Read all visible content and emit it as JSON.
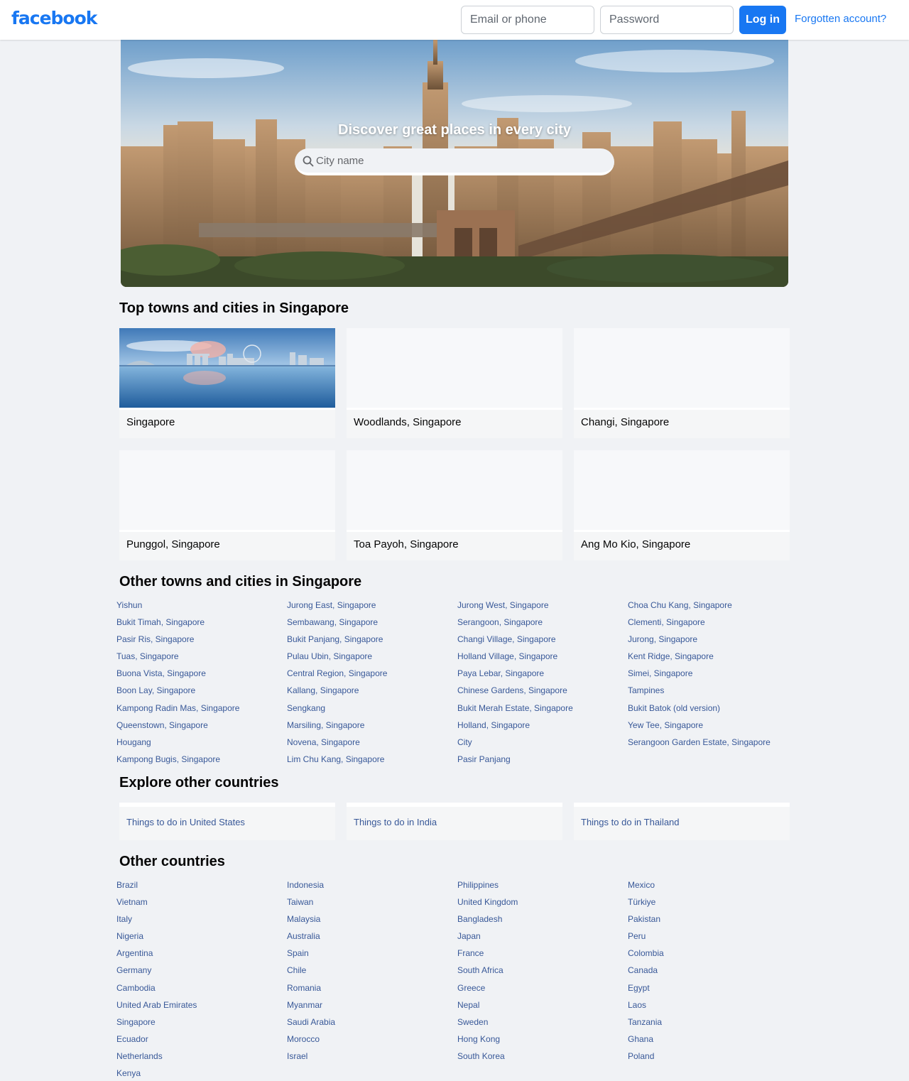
{
  "header": {
    "logo": "facebook",
    "email_placeholder": "Email or phone",
    "password_placeholder": "Password",
    "login_label": "Log in",
    "forgot_label": "Forgotten account?"
  },
  "hero": {
    "title": "Discover great places in every city",
    "search_placeholder": "City name"
  },
  "top_cities": {
    "title": "Top towns and cities in Singapore",
    "items": [
      {
        "label": "Singapore"
      },
      {
        "label": "Woodlands, Singapore"
      },
      {
        "label": "Changi, Singapore"
      },
      {
        "label": "Punggol, Singapore"
      },
      {
        "label": "Toa Payoh, Singapore"
      },
      {
        "label": "Ang Mo Kio, Singapore"
      }
    ]
  },
  "other_cities": {
    "title": "Other towns and cities in Singapore",
    "items": [
      "Yishun",
      "Jurong East, Singapore",
      "Jurong West, Singapore",
      "Choa Chu Kang, Singapore",
      "Bukit Timah, Singapore",
      "Sembawang, Singapore",
      "Serangoon, Singapore",
      "Clementi, Singapore",
      "Pasir Ris, Singapore",
      "Bukit Panjang, Singapore",
      "Changi Village, Singapore",
      "Jurong, Singapore",
      "Tuas, Singapore",
      "Pulau Ubin, Singapore",
      "Holland Village, Singapore",
      "Kent Ridge, Singapore",
      "Buona Vista, Singapore",
      "Central Region, Singapore",
      "Paya Lebar, Singapore",
      "Simei, Singapore",
      "Boon Lay, Singapore",
      "Kallang, Singapore",
      "Chinese Gardens, Singapore",
      "Tampines",
      "Kampong Radin Mas, Singapore",
      "Sengkang",
      "Bukit Merah Estate, Singapore",
      "Bukit Batok (old version)",
      "Queenstown, Singapore",
      "Marsiling, Singapore",
      "Holland, Singapore",
      "Yew Tee, Singapore",
      "Hougang",
      "Novena, Singapore",
      "City",
      "Serangoon Garden Estate, Singapore",
      "Kampong Bugis, Singapore",
      "Lim Chu Kang, Singapore",
      "Pasir Panjang"
    ]
  },
  "explore": {
    "title": "Explore other countries",
    "items": [
      "Things to do in United States",
      "Things to do in India",
      "Things to do in Thailand"
    ]
  },
  "other_countries": {
    "title": "Other countries",
    "items": [
      "Brazil",
      "Indonesia",
      "Philippines",
      "Mexico",
      "Vietnam",
      "Taiwan",
      "United Kingdom",
      "Türkiye",
      "Italy",
      "Malaysia",
      "Bangladesh",
      "Pakistan",
      "Nigeria",
      "Australia",
      "Japan",
      "Peru",
      "Argentina",
      "Spain",
      "France",
      "Colombia",
      "Germany",
      "Chile",
      "South Africa",
      "Canada",
      "Cambodia",
      "Romania",
      "Greece",
      "Egypt",
      "United Arab Emirates",
      "Myanmar",
      "Nepal",
      "Laos",
      "Singapore",
      "Saudi Arabia",
      "Sweden",
      "Tanzania",
      "Ecuador",
      "Morocco",
      "Hong Kong",
      "Ghana",
      "Netherlands",
      "Israel",
      "South Korea",
      "Poland",
      "Kenya"
    ]
  },
  "colors": {
    "brand": "#1877f2",
    "link": "#385898",
    "background": "#f0f2f5"
  }
}
